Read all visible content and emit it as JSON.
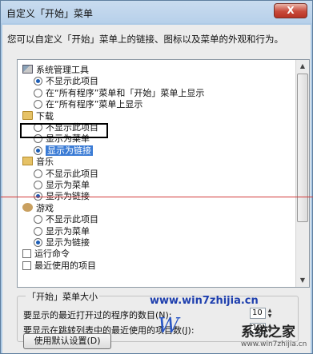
{
  "window": {
    "title": "自定义「开始」菜单",
    "close_label": "X"
  },
  "description": "您可以自定义「开始」菜单上的链接、图标以及菜单的外观和行为。",
  "list": {
    "items": [
      {
        "kind": "category",
        "icon": "tools-icon",
        "label": "系统管理工具"
      },
      {
        "kind": "radio",
        "checked": true,
        "label": "不显示此项目"
      },
      {
        "kind": "radio",
        "checked": false,
        "label": "在“所有程序”菜单和「开始」菜单上显示"
      },
      {
        "kind": "radio",
        "checked": false,
        "label": "在“所有程序”菜单上显示"
      },
      {
        "kind": "category",
        "icon": "folder-icon",
        "label": "下载"
      },
      {
        "kind": "radio",
        "checked": false,
        "label": "不显示此项目"
      },
      {
        "kind": "radio",
        "checked": false,
        "label": "显示为菜单"
      },
      {
        "kind": "radio",
        "checked": true,
        "label": "显示为链接",
        "selected": true
      },
      {
        "kind": "category",
        "icon": "music-icon",
        "label": "音乐"
      },
      {
        "kind": "radio",
        "checked": false,
        "label": "不显示此项目"
      },
      {
        "kind": "radio",
        "checked": false,
        "label": "显示为菜单"
      },
      {
        "kind": "radio",
        "checked": true,
        "label": "显示为链接"
      },
      {
        "kind": "category",
        "icon": "games-icon",
        "label": "游戏"
      },
      {
        "kind": "radio",
        "checked": false,
        "label": "不显示此项目"
      },
      {
        "kind": "radio",
        "checked": false,
        "label": "显示为菜单"
      },
      {
        "kind": "radio",
        "checked": true,
        "label": "显示为链接"
      },
      {
        "kind": "checkbox",
        "checked": false,
        "label": "运行命令"
      },
      {
        "kind": "checkbox",
        "checked": false,
        "label": "最近使用的项目"
      }
    ]
  },
  "size_group": {
    "title": "「开始」菜单大小",
    "recent_programs_label": "要显示的最近打开过的程序的数目(N):",
    "recent_programs_value": "10",
    "jumplist_label": "要显示在跳转列表中的最近使用的项目数(J):",
    "jumplist_value": "10"
  },
  "default_button": "使用默认设置(D)",
  "watermark": {
    "url_overlay": "www.win7zhijia.cn",
    "logo": "W",
    "site_name": "系统之家",
    "site_url": "www.win7zhijia.cn"
  },
  "colors": {
    "selection": "#3a7bd5",
    "accent_line": "#d23a3a",
    "close": "#c8493a"
  }
}
